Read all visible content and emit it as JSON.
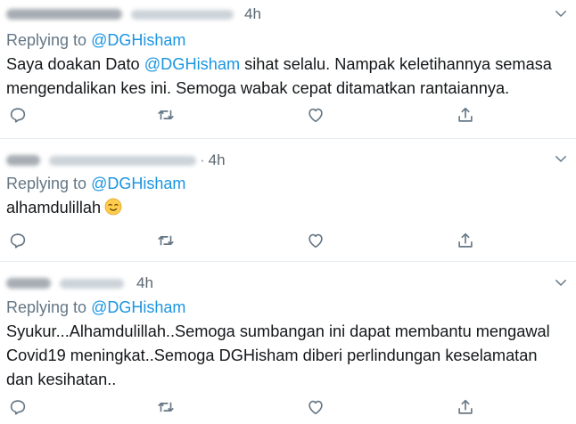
{
  "colors": {
    "link": "#1b95e0",
    "muted": "#657786",
    "text": "#14171a",
    "divider": "#e6ecf0",
    "icon": "#657786"
  },
  "tweets": [
    {
      "time": "4h",
      "replying_prefix": "Replying to ",
      "replying_handle": "@DGHisham",
      "lines": [
        {
          "a": "Saya doakan Dato ",
          "m": "@DGHisham",
          "b": " sihat selalu. Nampak keletihannya semasa"
        },
        {
          "a": "mengendalikan kes ini. Semoga wabak cepat ditamatkan rantaiannya."
        }
      ]
    },
    {
      "time": "4h",
      "dot": "·",
      "replying_prefix": "Replying to ",
      "replying_handle": "@DGHisham",
      "lines": [
        {
          "a": "alhamdulillah"
        }
      ],
      "emoji": "relieved-face-icon"
    },
    {
      "time": "4h",
      "replying_prefix": "Replying to ",
      "replying_handle": "@DGHisham",
      "lines": [
        {
          "a": "Syukur...Alhamdulillah..Semoga sumbangan ini dapat membantu mengawal"
        },
        {
          "a": "Covid19 meningkat..Semoga DGHisham diberi perlindungan keselamatan"
        },
        {
          "a": "dan kesihatan.."
        }
      ]
    }
  ],
  "icons": [
    "reply-icon",
    "retweet-icon",
    "like-icon",
    "share-icon",
    "chevron-down-icon"
  ]
}
